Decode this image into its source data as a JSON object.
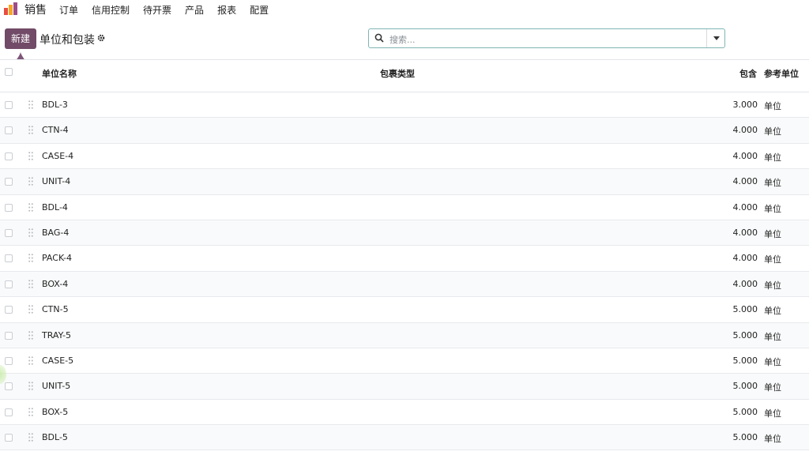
{
  "topbar": {
    "app_name": "销售",
    "menu": [
      "订单",
      "信用控制",
      "待开票",
      "产品",
      "报表",
      "配置"
    ]
  },
  "control": {
    "new_label": "新建",
    "breadcrumb": "单位和包装",
    "search_placeholder": "搜索..."
  },
  "table": {
    "headers": {
      "name": "单位名称",
      "package_type": "包裹类型",
      "contains": "包含",
      "ref_uom": "参考单位"
    },
    "rows": [
      {
        "name": "BDL-3",
        "qty": "3.000",
        "uom": "单位"
      },
      {
        "name": "CTN-4",
        "qty": "4.000",
        "uom": "单位"
      },
      {
        "name": "CASE-4",
        "qty": "4.000",
        "uom": "单位"
      },
      {
        "name": "UNIT-4",
        "qty": "4.000",
        "uom": "单位"
      },
      {
        "name": "BDL-4",
        "qty": "4.000",
        "uom": "单位"
      },
      {
        "name": "BAG-4",
        "qty": "4.000",
        "uom": "单位"
      },
      {
        "name": "PACK-4",
        "qty": "4.000",
        "uom": "单位"
      },
      {
        "name": "BOX-4",
        "qty": "4.000",
        "uom": "单位"
      },
      {
        "name": "CTN-5",
        "qty": "5.000",
        "uom": "单位"
      },
      {
        "name": "TRAY-5",
        "qty": "5.000",
        "uom": "单位"
      },
      {
        "name": "CASE-5",
        "qty": "5.000",
        "uom": "单位"
      },
      {
        "name": "UNIT-5",
        "qty": "5.000",
        "uom": "单位"
      },
      {
        "name": "BOX-5",
        "qty": "5.000",
        "uom": "单位"
      },
      {
        "name": "BDL-5",
        "qty": "5.000",
        "uom": "单位"
      }
    ]
  },
  "colors": {
    "brand": "#714b67",
    "search_border": "#7fb6b4"
  }
}
